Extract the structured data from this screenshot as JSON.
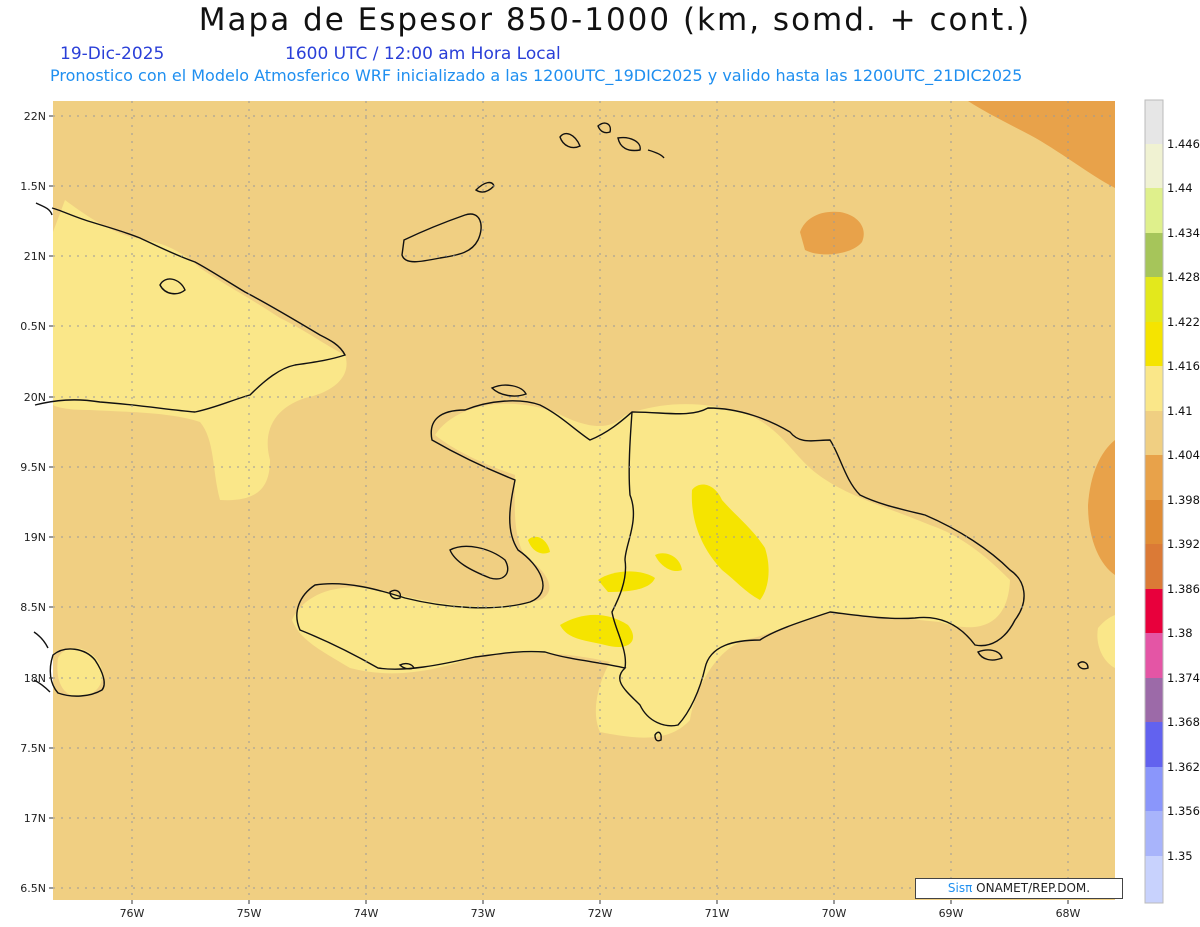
{
  "header": {
    "title": "Mapa de Espesor 850-1000 (km, somd. + cont.)",
    "date": "19-Dic-2025",
    "time": "1600 UTC / 12:00 am Hora Local",
    "description": "Pronostico con el Modelo Atmosferico WRF inicializado a las 1200UTC_19DIC2025 y valido hasta las  1200UTC_21DIC2025"
  },
  "map": {
    "lon_labels": [
      "76W",
      "75W",
      "74W",
      "73W",
      "72W",
      "71W",
      "70W",
      "69W",
      "68W"
    ],
    "lat_labels": [
      "22N",
      "1.5N",
      "21N",
      "0.5N",
      "20N",
      "9.5N",
      "19N",
      "8.5N",
      "18N",
      "7.5N",
      "17N",
      "6.5N"
    ],
    "colors": {
      "background_thickness": "#f0cf82",
      "light_yellow": "#fae789",
      "yellow": "#f5e400",
      "orange": "#e8a24a"
    }
  },
  "colorbar": {
    "labels": [
      "1.446",
      "1.44",
      "1.434",
      "1.428",
      "1.422",
      "1.416",
      "1.41",
      "1.404",
      "1.398",
      "1.392",
      "1.386",
      "1.38",
      "1.374",
      "1.368",
      "1.362",
      "1.356",
      "1.35"
    ],
    "colors": [
      "#e6e6e6",
      "#f0f2d2",
      "#dff08c",
      "#a6c55a",
      "#e3e81c",
      "#f5e400",
      "#fae789",
      "#f0cf82",
      "#e8a24a",
      "#e08c35",
      "#db7a36",
      "#e8003c",
      "#e455a5",
      "#9c6aa8",
      "#6262ef",
      "#8a96fb",
      "#a8b4fb",
      "#c8d2fd"
    ]
  },
  "credit": {
    "sis": "Sisπ",
    "text": " ONAMET/REP.DOM."
  }
}
